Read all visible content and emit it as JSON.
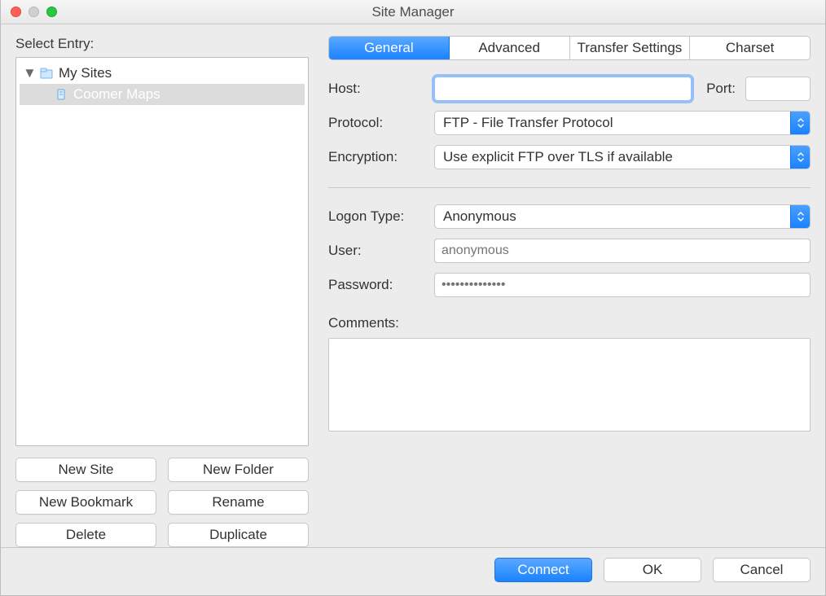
{
  "window": {
    "title": "Site Manager"
  },
  "left": {
    "label": "Select Entry:",
    "root": "My Sites",
    "site": "Coomer Maps",
    "buttons": {
      "new_site": "New Site",
      "new_folder": "New Folder",
      "new_bookmark": "New Bookmark",
      "rename": "Rename",
      "delete": "Delete",
      "duplicate": "Duplicate"
    }
  },
  "tabs": {
    "general": "General",
    "advanced": "Advanced",
    "transfer": "Transfer Settings",
    "charset": "Charset"
  },
  "form": {
    "host_label": "Host:",
    "port_label": "Port:",
    "protocol_label": "Protocol:",
    "protocol_value": "FTP - File Transfer Protocol",
    "encryption_label": "Encryption:",
    "encryption_value": "Use explicit FTP over TLS if available",
    "logon_label": "Logon Type:",
    "logon_value": "Anonymous",
    "user_label": "User:",
    "user_placeholder": "anonymous",
    "password_label": "Password:",
    "password_placeholder": "••••••••••••••",
    "comments_label": "Comments:"
  },
  "footer": {
    "connect": "Connect",
    "ok": "OK",
    "cancel": "Cancel"
  }
}
